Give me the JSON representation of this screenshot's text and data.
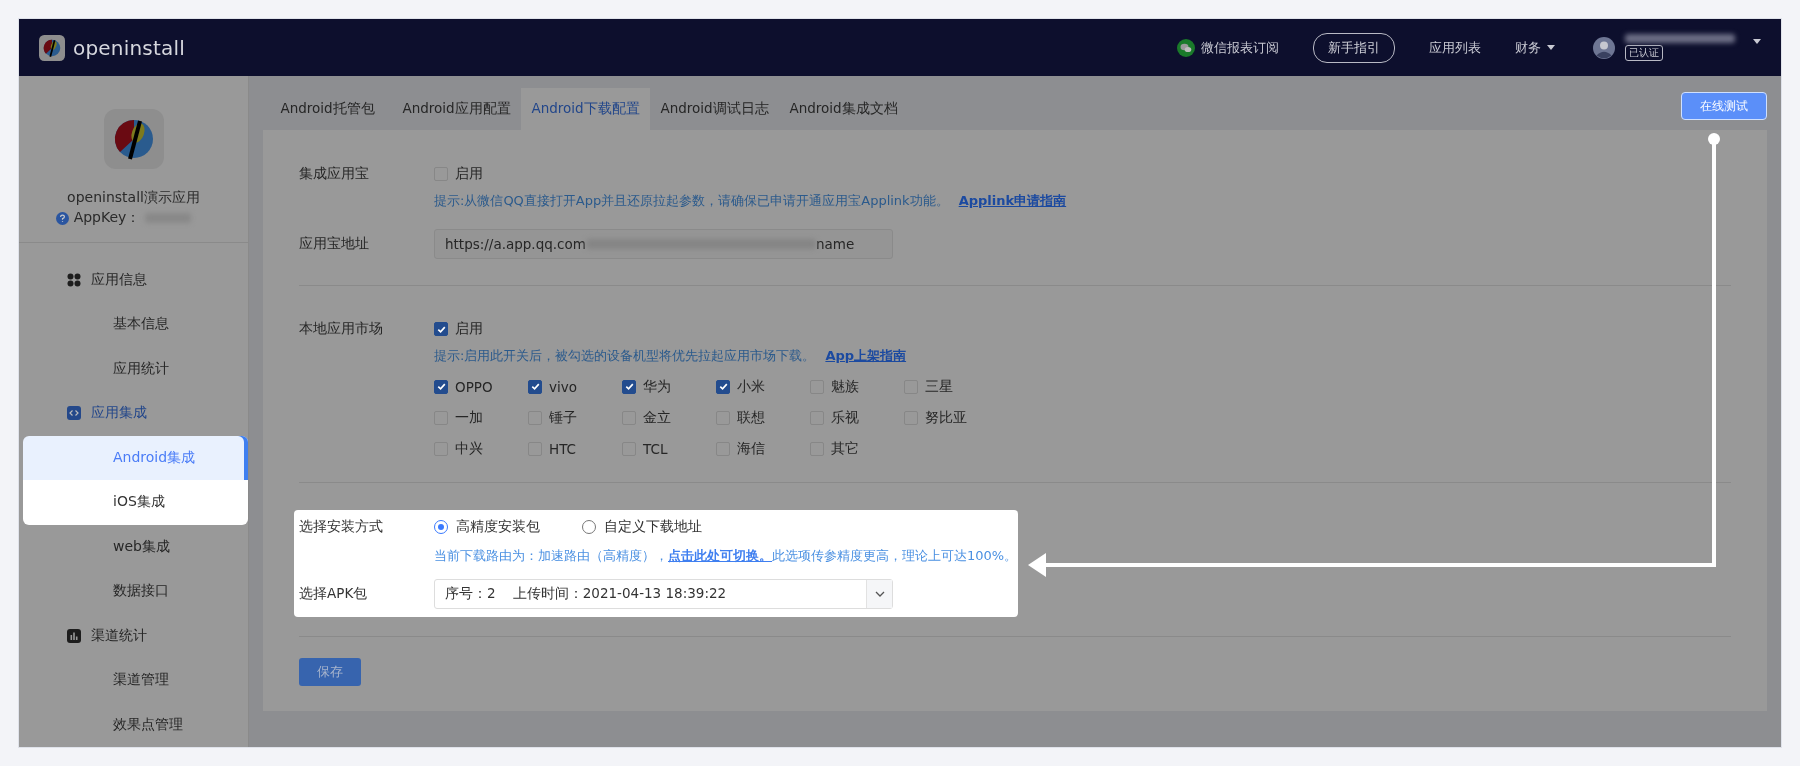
{
  "header": {
    "logo_text": "openinstall",
    "nav": [
      {
        "kind": "wechat",
        "label": "微信报表订阅"
      },
      {
        "kind": "pill",
        "label": "新手指引"
      },
      {
        "kind": "link",
        "label": "应用列表"
      },
      {
        "kind": "dropdown",
        "label": "财务"
      }
    ],
    "user": {
      "badge": "已认证"
    }
  },
  "sidebar": {
    "app_name": "openinstall演示应用",
    "appkey_label": "AppKey：",
    "menu": [
      {
        "label": "应用信息",
        "kind": "grid",
        "selected": false,
        "children": [
          {
            "label": "基本信息",
            "selected": false,
            "spotlight": false
          },
          {
            "label": "应用统计",
            "selected": false,
            "spotlight": false
          }
        ]
      },
      {
        "label": "应用集成",
        "kind": "code",
        "selected": true,
        "children": [
          {
            "label": "Android集成",
            "selected": true,
            "spotlight": true
          },
          {
            "label": "iOS集成",
            "selected": false,
            "spotlight": true
          },
          {
            "label": "web集成",
            "selected": false,
            "spotlight": false
          },
          {
            "label": "数据接口",
            "selected": false,
            "spotlight": false
          }
        ]
      },
      {
        "label": "渠道统计",
        "kind": "chart",
        "selected": false,
        "children": [
          {
            "label": "渠道管理",
            "selected": false,
            "spotlight": false
          },
          {
            "label": "效果点管理",
            "selected": false,
            "spotlight": false
          }
        ]
      }
    ]
  },
  "tabs": [
    {
      "label": "Android托管包",
      "selected": false
    },
    {
      "label": "Android应用配置",
      "selected": false
    },
    {
      "label": "Android下载配置",
      "selected": true
    },
    {
      "label": "Android调试日志",
      "selected": false
    },
    {
      "label": "Android集成文档",
      "selected": false
    }
  ],
  "test_button": {
    "label": "在线测试",
    "spotlight": true
  },
  "form": {
    "app_store": {
      "label": "集成应用宝",
      "option": {
        "label": "启用",
        "checked": false
      },
      "hint": "提示:从微信QQ直接打开App并且还原拉起参数，请确保已申请开通应用宝Applink功能。",
      "hint_link": "Applink申请指南"
    },
    "store_url": {
      "label": "应用宝地址",
      "value_start": "https://a.app.qq.com",
      "value_end": "name"
    },
    "local_market": {
      "label": "本地应用市场",
      "option": {
        "label": "启用",
        "checked": true
      },
      "hint": "提示:启用此开关后，被勾选的设备机型将优先拉起应用市场下载。",
      "hint_link": "App上架指南",
      "brands": [
        {
          "label": "OPPO",
          "checked": true
        },
        {
          "label": "vivo",
          "checked": true
        },
        {
          "label": "华为",
          "checked": true
        },
        {
          "label": "小米",
          "checked": true
        },
        {
          "label": "魅族",
          "checked": false
        },
        {
          "label": "三星",
          "checked": false
        },
        {
          "label": "一加",
          "checked": false
        },
        {
          "label": "锤子",
          "checked": false
        },
        {
          "label": "金立",
          "checked": false
        },
        {
          "label": "联想",
          "checked": false
        },
        {
          "label": "乐视",
          "checked": false
        },
        {
          "label": "努比亚",
          "checked": false
        },
        {
          "label": "中兴",
          "checked": false
        },
        {
          "label": "HTC",
          "checked": false
        },
        {
          "label": "TCL",
          "checked": false
        },
        {
          "label": "海信",
          "checked": false
        },
        {
          "label": "其它",
          "checked": false
        }
      ]
    },
    "install_method": {
      "label": "选择安装方式",
      "spotlight": true,
      "options": [
        {
          "label": "高精度安装包",
          "selected": true
        },
        {
          "label": "自定义下载地址",
          "selected": false
        }
      ],
      "hint_before": "当前下载路由为：加速路由（高精度），",
      "hint_link": "点击此处可切换。",
      "hint_after": "此选项传参精度更高，理论上可达100%。"
    },
    "apk": {
      "label": "选择APK包",
      "value": "序号：2    上传时间：2021-04-13 18:39:22"
    },
    "save_button": "保存"
  }
}
